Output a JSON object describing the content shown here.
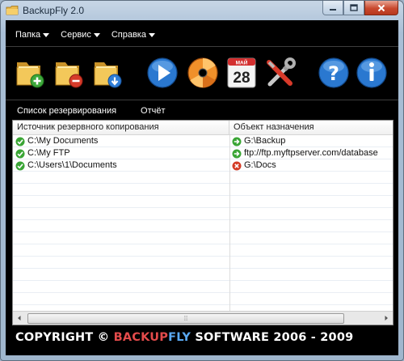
{
  "window": {
    "title": "BackupFly 2.0"
  },
  "menu": [
    {
      "label": "Папка"
    },
    {
      "label": "Сервис"
    },
    {
      "label": "Справка"
    }
  ],
  "tabs": [
    {
      "label": "Список резервирования"
    },
    {
      "label": "Отчёт"
    }
  ],
  "toolbar": {
    "calendar_month": "МАЙ",
    "calendar_day": "28"
  },
  "grid": {
    "columns": [
      "Источник резервного копирования",
      "Объект назначения"
    ],
    "rows": [
      {
        "source": "C:\\My Documents",
        "source_status": "ok",
        "destination": "G:\\Backup",
        "destination_status": "arrow"
      },
      {
        "source": "C:\\My FTP",
        "source_status": "ok",
        "destination": "ftp://ftp.myftpserver.com/database",
        "destination_status": "arrow"
      },
      {
        "source": "C:\\Users\\1\\Documents",
        "source_status": "ok",
        "destination": "G:\\Docs",
        "destination_status": "error"
      }
    ]
  },
  "footer": {
    "prefix": "COPYRIGHT © ",
    "brand_part1": "BACKUP",
    "brand_part2": "FLY",
    "suffix": " SOFTWARE 2006 - 2009"
  },
  "colors": {
    "brand_red": "#e34b4b",
    "brand_blue": "#5aa8f0",
    "ok_green": "#3aa535",
    "error_red": "#d43b25"
  }
}
